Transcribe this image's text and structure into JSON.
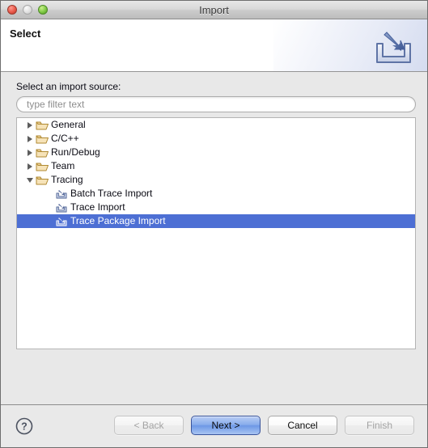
{
  "window": {
    "title": "Import",
    "traffic_lights": [
      "close-button",
      "minimize-button",
      "zoom-button"
    ]
  },
  "header": {
    "title": "Select",
    "icon": "import-wizard-icon"
  },
  "body": {
    "source_label": "Select an import source:",
    "filter": {
      "value": "",
      "placeholder": "type filter text"
    },
    "tree": [
      {
        "label": "General",
        "state": "collapsed",
        "icon": "folder-icon",
        "level": 0,
        "selected": false
      },
      {
        "label": "C/C++",
        "state": "collapsed",
        "icon": "folder-icon",
        "level": 0,
        "selected": false
      },
      {
        "label": "Run/Debug",
        "state": "collapsed",
        "icon": "folder-icon",
        "level": 0,
        "selected": false
      },
      {
        "label": "Team",
        "state": "collapsed",
        "icon": "folder-icon",
        "level": 0,
        "selected": false
      },
      {
        "label": "Tracing",
        "state": "expanded",
        "icon": "folder-icon",
        "level": 0,
        "selected": false
      },
      {
        "label": "Batch Trace Import",
        "state": "leaf",
        "icon": "import-icon",
        "level": 1,
        "selected": false
      },
      {
        "label": "Trace Import",
        "state": "leaf",
        "icon": "import-icon",
        "level": 1,
        "selected": false
      },
      {
        "label": "Trace Package Import",
        "state": "leaf",
        "icon": "import-icon",
        "level": 1,
        "selected": true
      }
    ]
  },
  "buttons": {
    "help": "?",
    "back": {
      "label": "< Back",
      "enabled": false,
      "default": false
    },
    "next": {
      "label": "Next >",
      "enabled": true,
      "default": true
    },
    "cancel": {
      "label": "Cancel",
      "enabled": true,
      "default": false
    },
    "finish": {
      "label": "Finish",
      "enabled": false,
      "default": false
    }
  },
  "colors": {
    "selection": "#4d6fd4",
    "folder": "#e8c07a",
    "default_button": "#89adec",
    "body_background": "#e8e8e8"
  }
}
